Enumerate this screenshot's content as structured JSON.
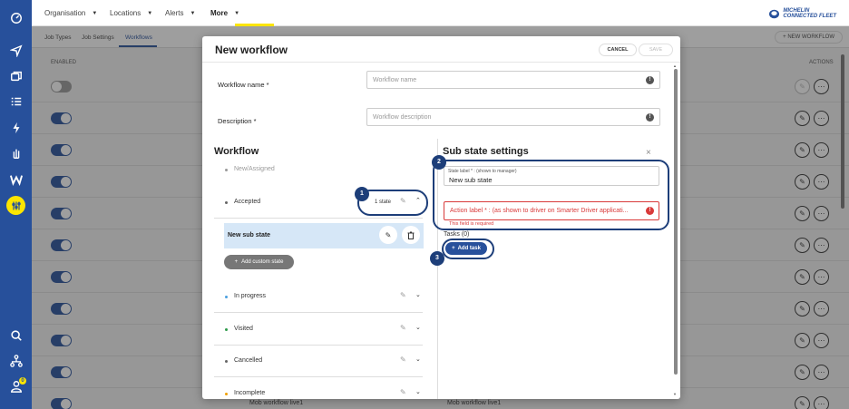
{
  "nav": {
    "items": [
      {
        "label": "Organisation"
      },
      {
        "label": "Locations"
      },
      {
        "label": "Alerts"
      },
      {
        "label": "More"
      }
    ],
    "brand": {
      "line1": "MICHELIN",
      "line2": "CONNECTED FLEET"
    }
  },
  "subtabs": {
    "items": [
      {
        "label": "Job Types"
      },
      {
        "label": "Job Settings"
      },
      {
        "label": "Workflows"
      }
    ],
    "new_workflow": "+ NEW WORKFLOW"
  },
  "table": {
    "col_enabled": "ENABLED",
    "col_actions": "ACTIONS",
    "bottom_text_1": "Mob workflow live1",
    "bottom_text_2": "Mob workflow live1"
  },
  "sidebar": {
    "badge": "0"
  },
  "modal": {
    "title": "New workflow",
    "cancel": "CANCEL",
    "save": "SAVE",
    "workflow_name_label": "Workflow name *",
    "workflow_name_placeholder": "Workflow name",
    "description_label": "Description *",
    "description_placeholder": "Workflow description",
    "workflow_section": "Workflow",
    "states": [
      {
        "label": "New/Assigned",
        "dot_color": "#999999"
      },
      {
        "label": "Accepted",
        "count": "1 state",
        "dot_color": "#555555"
      },
      {
        "label": "In progress",
        "dot_color": "#4a9fe0"
      },
      {
        "label": "Visited",
        "dot_color": "#2e9b4a"
      },
      {
        "label": "Cancelled",
        "dot_color": "#555555"
      },
      {
        "label": "Incomplete",
        "dot_color": "#f0a000"
      }
    ],
    "substate_label": "New sub state",
    "add_custom_state": "Add custom state",
    "sub_state_settings": "Sub state settings",
    "state_label_caption": "State label * : (shown to manager)",
    "state_label_value": "New sub state",
    "action_label_placeholder": "Action label * : (as shown to driver on Smarter Driver applicati...",
    "error_message": "This field is required",
    "tasks_label": "Tasks (0)",
    "add_task": "Add task",
    "callouts": [
      "1",
      "2",
      "3"
    ]
  },
  "colors": {
    "sidebar": "#27509b",
    "accent": "#fce500",
    "callout": "#1d3e79",
    "error": "#d93a3a"
  }
}
